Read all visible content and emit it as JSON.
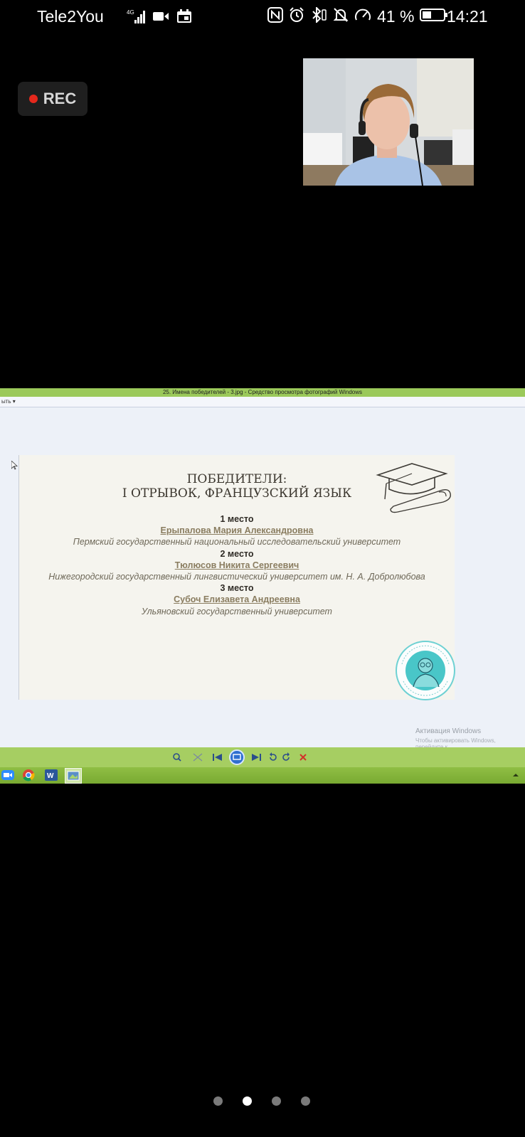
{
  "status_bar": {
    "carrier": "Tele2You",
    "network": "4G",
    "battery_percent": "41 %",
    "time": "14:21",
    "icons_left": [
      "signal-icon",
      "video-camera-icon",
      "calendar-icon"
    ],
    "icons_right": [
      "nfc-icon",
      "alarm-icon",
      "bluetooth-icon",
      "mute-icon",
      "speed-icon",
      "battery-icon"
    ]
  },
  "recording": {
    "label": "REC",
    "dot_color": "#e5281c"
  },
  "shared_window": {
    "title": "25. Имена победителей - 3.jpg - Средство просмотра фотографий Windows",
    "menu_item": "ыть ▾",
    "activation_title": "Активация Windows",
    "activation_text": "Чтобы активировать Windows, перейдите к"
  },
  "slide": {
    "title_line1": "ПОБЕДИТЕЛИ:",
    "title_line2": "I ОТРЫВОК, ФРАНЦУЗСКИЙ ЯЗЫК",
    "entries": [
      {
        "place": "1 место",
        "name": "Ерыпалова Мария Александровна",
        "university": "Пермский государственный национальный исследовательский университет"
      },
      {
        "place": "2 место",
        "name": "Тюлюсов Никита Сергеевич",
        "university": "Нижегородский государственный лингвистический университет им. Н. А. Добролюбова"
      },
      {
        "place": "3 место",
        "name": "Субоч Елизавета Андреевна",
        "university": "Ульяновский государственный университет"
      }
    ]
  },
  "pagination": {
    "total": 4,
    "active_index": 1
  },
  "colors": {
    "accent_green": "#9bc95a",
    "slide_bg": "#f5f4ee",
    "seal_teal": "#3fc7c9"
  }
}
